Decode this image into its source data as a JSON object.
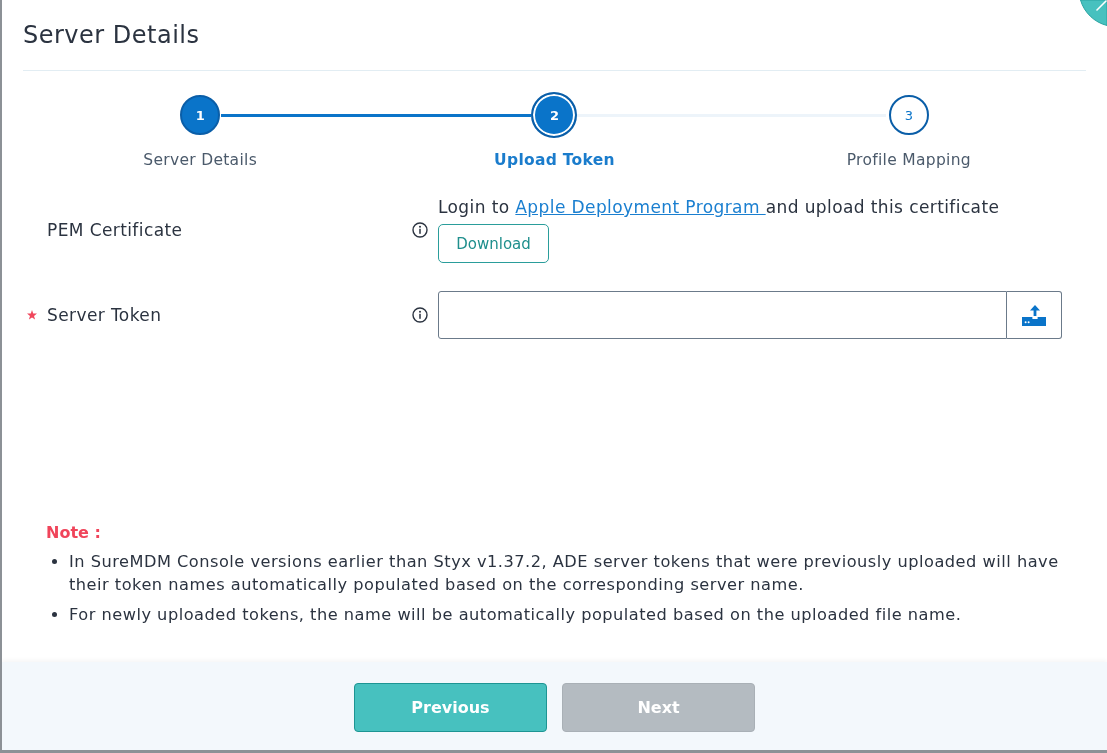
{
  "dialog": {
    "title": "Server Details"
  },
  "steps": [
    {
      "number": "1",
      "label": "Server Details",
      "completed": true,
      "selected": false
    },
    {
      "number": "2",
      "label": "Upload Token",
      "completed": false,
      "selected": true
    },
    {
      "number": "3",
      "label": "Profile Mapping",
      "completed": false,
      "selected": false
    }
  ],
  "fields": [
    {
      "kind": "certificate",
      "label": "PEM Certificate",
      "required": false,
      "text_before": "Login to",
      "link": "Apple Deployment Program",
      "text_after": "and upload this certificate",
      "button": "Download"
    },
    {
      "kind": "upload",
      "label": "Server Token",
      "required": true
    }
  ],
  "note": {
    "title": "Note :",
    "items": [
      "In SureMDM Console versions earlier than Styx v1.37.2, ADE server tokens that were previously uploaded will have their token names automatically populated based on the corresponding server name.",
      "For newly uploaded tokens, the name will be automatically populated based on the uploaded file name."
    ]
  },
  "footer": {
    "buttons": [
      {
        "label": "Previous",
        "disabled": false
      },
      {
        "label": "Next",
        "disabled": true
      }
    ]
  }
}
